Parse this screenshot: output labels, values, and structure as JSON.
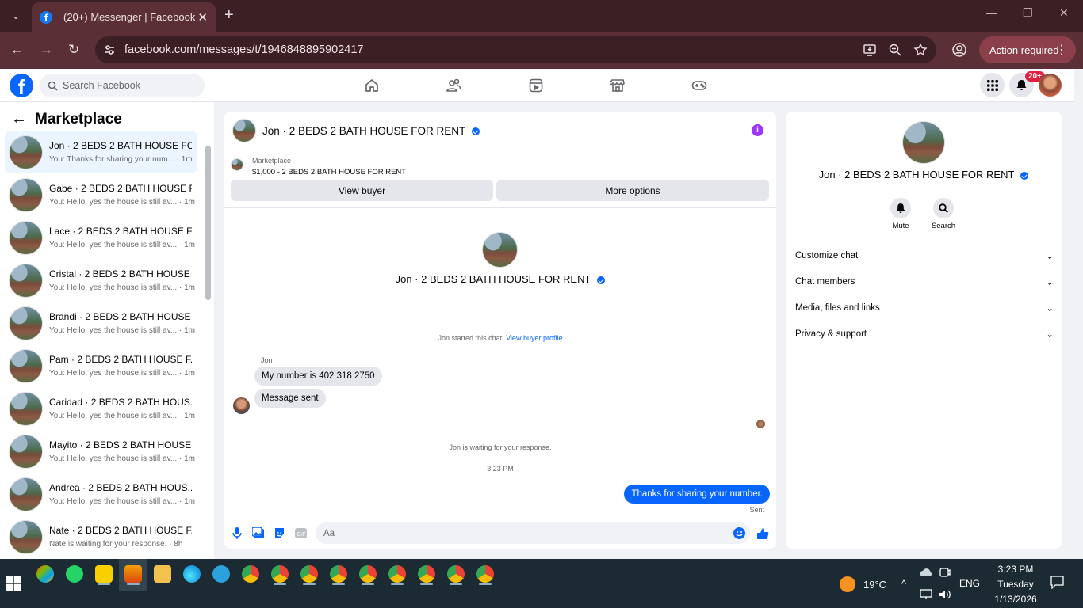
{
  "browser": {
    "tab_title": "(20+) Messenger | Facebook",
    "url": "facebook.com/messages/t/1946848895902417",
    "action_label": "Action required"
  },
  "fb": {
    "search_placeholder": "Search Facebook",
    "notification_badge": "20+",
    "brand_color": "#0866ff"
  },
  "sidebar": {
    "title": "Marketplace",
    "conversations": [
      {
        "name": "Jon · 2 BEDS 2 BATH HOUSE FO...",
        "preview": "You: Thanks for sharing your num... · 1m",
        "active": true
      },
      {
        "name": "Gabe · 2 BEDS 2 BATH HOUSE F...",
        "preview": "You: Hello, yes the house is still av... · 1m"
      },
      {
        "name": "Lace · 2 BEDS 2 BATH HOUSE F...",
        "preview": "You: Hello, yes the house is still av... · 1m"
      },
      {
        "name": "Cristal · 2 BEDS 2 BATH HOUSE ...",
        "preview": "You: Hello, yes the house is still av... · 1m"
      },
      {
        "name": "Brandi · 2 BEDS 2 BATH HOUSE ...",
        "preview": "You: Hello, yes the house is still av... · 1m"
      },
      {
        "name": "Pam · 2 BEDS 2 BATH HOUSE F...",
        "preview": "You: Hello, yes the house is still av... · 1m"
      },
      {
        "name": "Caridad · 2 BEDS 2 BATH HOUS...",
        "preview": "You: Hello, yes the house is still av... · 1m"
      },
      {
        "name": "Mayito · 2 BEDS 2 BATH HOUSE...",
        "preview": "You: Hello, yes the house is still av... · 1m"
      },
      {
        "name": "Andrea · 2 BEDS 2 BATH HOUS...",
        "preview": "You: Hello, yes the house is still av... · 1m"
      },
      {
        "name": "Nate · 2 BEDS 2 BATH HOUSE F...",
        "preview": "Nate is waiting for your response. · 8h"
      }
    ]
  },
  "chat": {
    "title": "Jon · 2 BEDS 2 BATH HOUSE FOR RENT",
    "marketplace_label": "Marketplace",
    "listing": "$1,000 - 2 BEDS 2 BATH HOUSE FOR RENT",
    "view_buyer": "View buyer",
    "more_options": "More options",
    "center_name": "Jon · 2 BEDS 2 BATH HOUSE FOR RENT",
    "started_text": "Jon started this chat.",
    "started_link": "View buyer profile",
    "sender": "Jon",
    "msg1": "My number is 402 318 2750",
    "msg2": "Message sent",
    "waiting": "Jon is waiting for your response.",
    "timestamp": "3:23 PM",
    "outgoing": "Thanks for sharing your number.",
    "status": "Sent",
    "input_placeholder": "Aa"
  },
  "info_panel": {
    "name": "Jon · 2 BEDS 2 BATH HOUSE FOR RENT",
    "mute": "Mute",
    "search": "Search",
    "sections": [
      "Customize chat",
      "Chat members",
      "Media, files and links",
      "Privacy & support"
    ]
  },
  "taskbar": {
    "temperature": "19°C",
    "language": "ENG",
    "time": "3:23 PM",
    "day": "Tuesday",
    "date": "1/13/2026"
  }
}
